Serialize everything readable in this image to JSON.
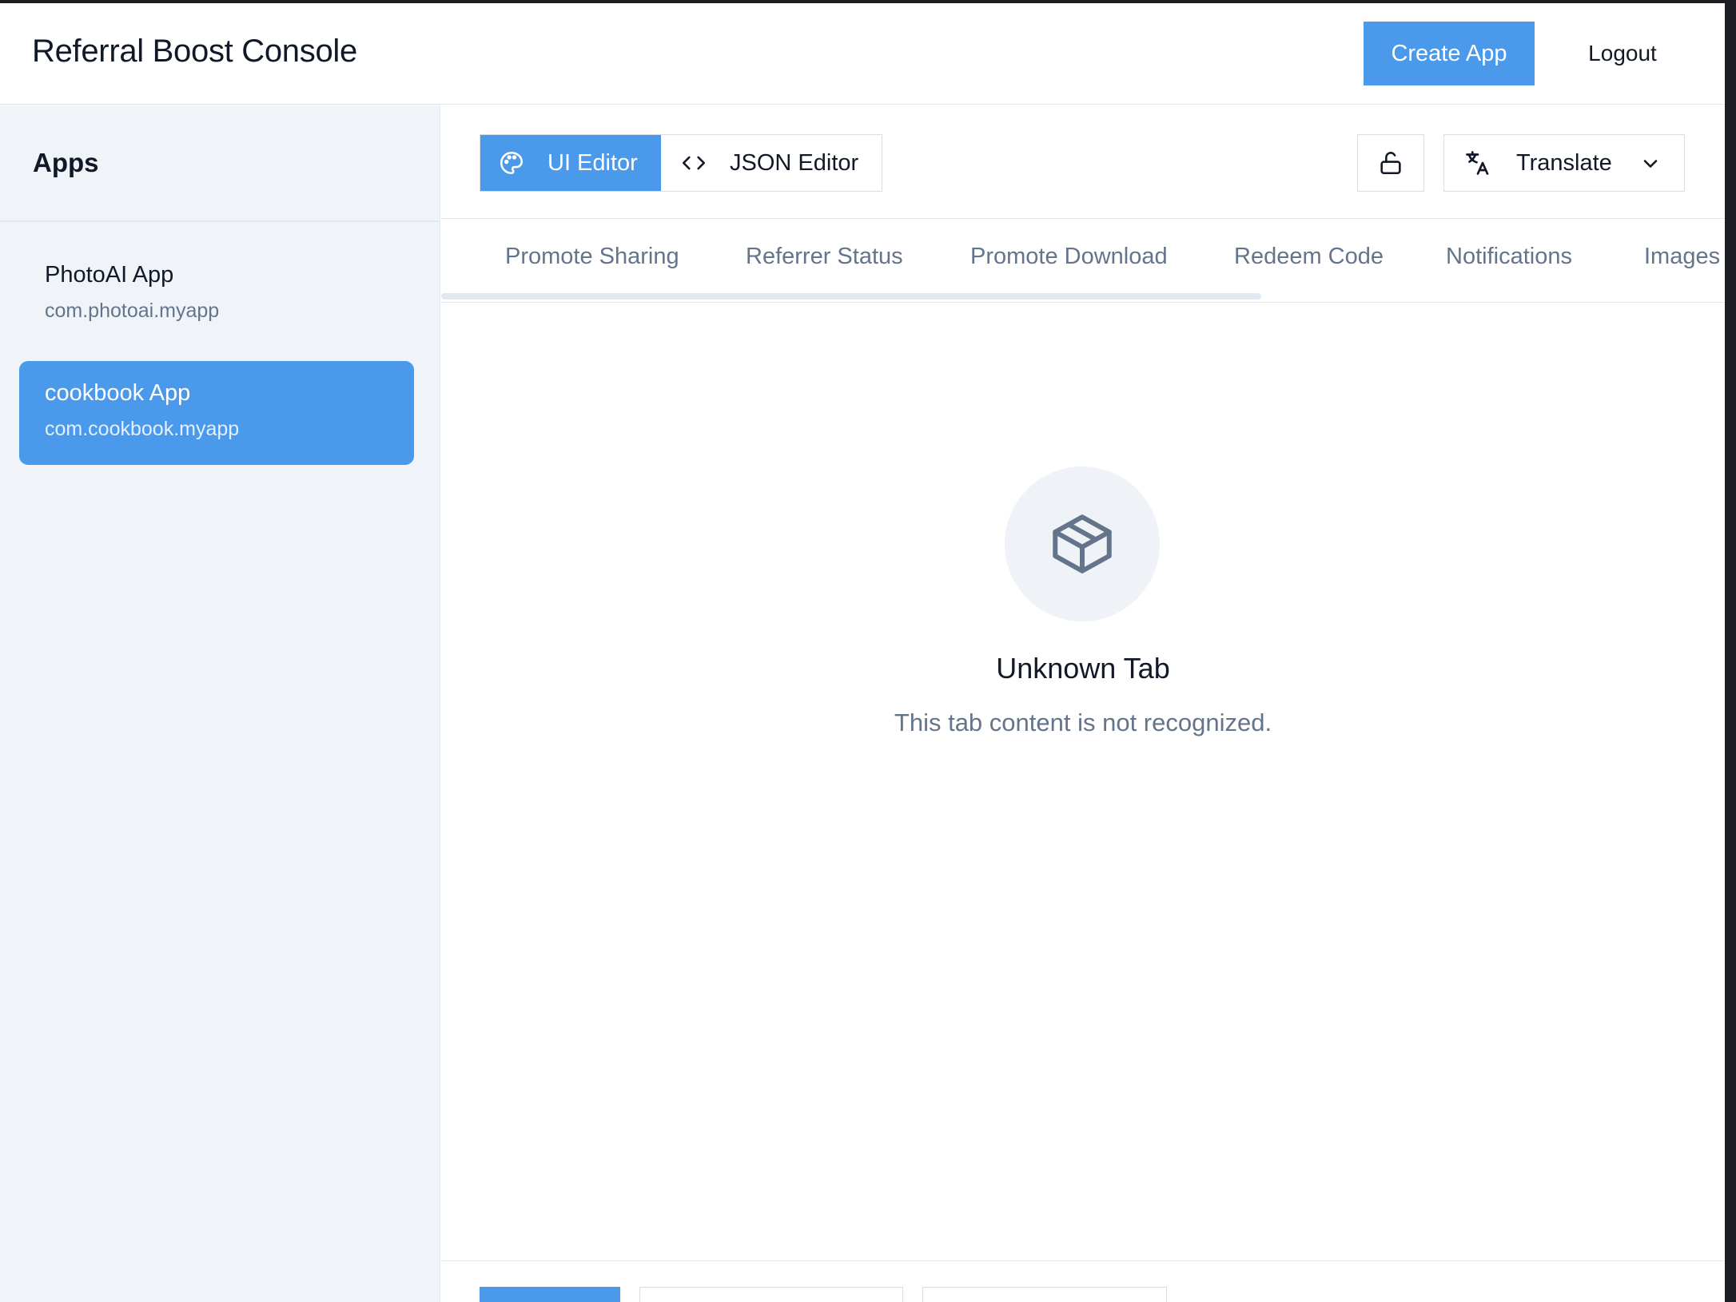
{
  "header": {
    "title": "Referral Boost Console",
    "create_app_label": "Create App",
    "logout_label": "Logout"
  },
  "sidebar": {
    "heading": "Apps",
    "apps": [
      {
        "name": "PhotoAI App",
        "bundle": "com.photoai.myapp",
        "selected": false
      },
      {
        "name": "cookbook App",
        "bundle": "com.cookbook.myapp",
        "selected": true
      }
    ]
  },
  "toolbar": {
    "modes": [
      {
        "label": "UI Editor",
        "icon": "palette-icon",
        "active": true
      },
      {
        "label": "JSON Editor",
        "icon": "code-icon",
        "active": false
      }
    ],
    "lock_icon": "unlock-icon",
    "translate_label": "Translate",
    "translate_icon": "translate-icon"
  },
  "tabs": [
    "Promote Sharing",
    "Referrer Status",
    "Promote Download",
    "Redeem Code",
    "Notifications",
    "Images"
  ],
  "empty_state": {
    "icon": "package-icon",
    "title": "Unknown Tab",
    "message": "This tab content is not recognized."
  },
  "colors": {
    "accent": "#4a99ea",
    "sidebar_bg": "#f0f4f8",
    "muted_text": "#64748b"
  }
}
